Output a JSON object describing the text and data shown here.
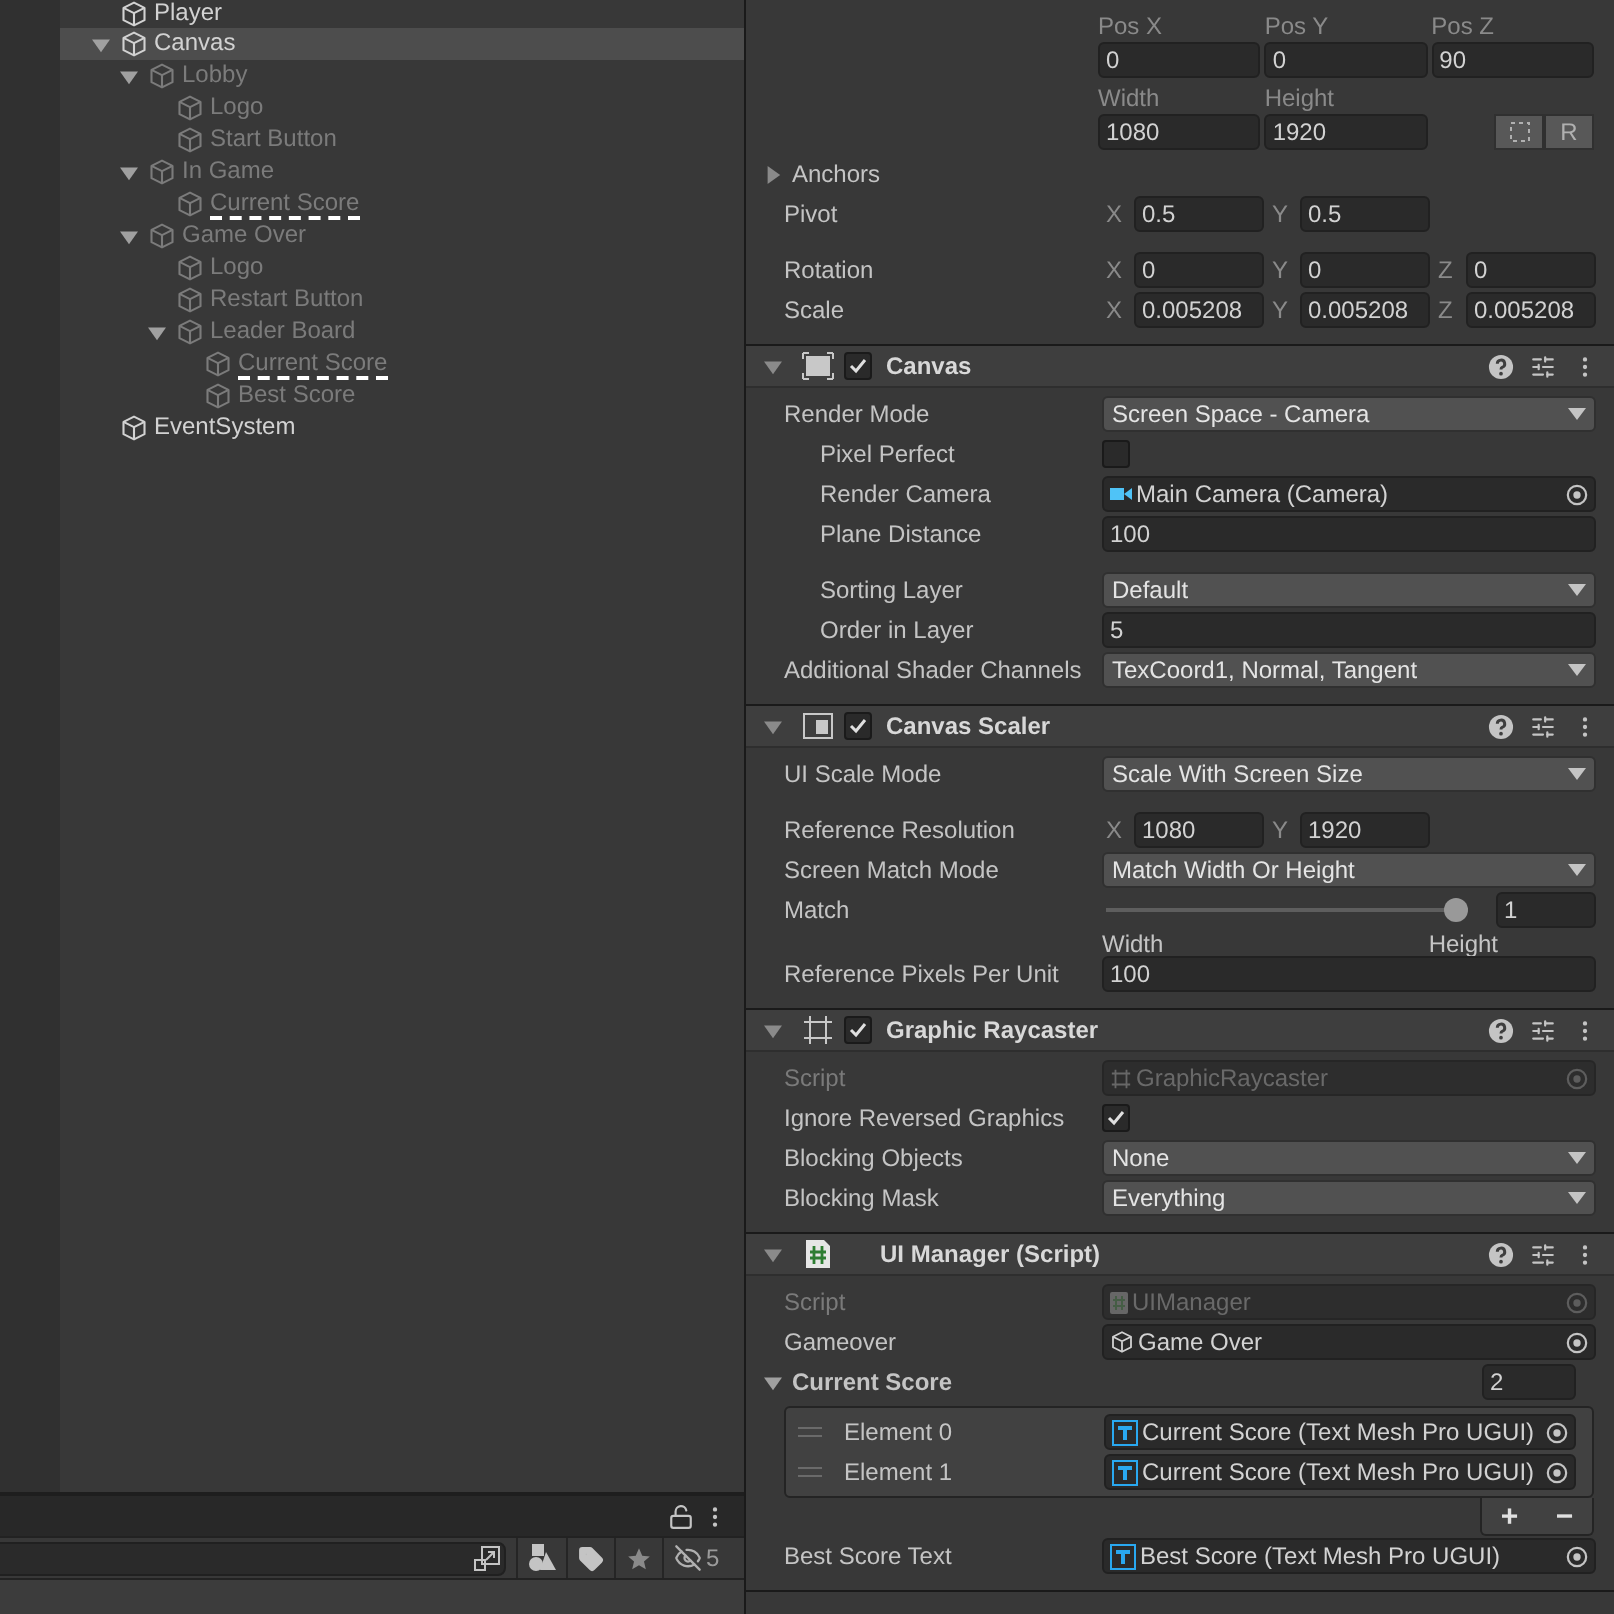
{
  "hierarchy": {
    "items": [
      {
        "name": "Player",
        "active": true,
        "selected": false
      },
      {
        "name": "Canvas",
        "active": true,
        "selected": true,
        "expanded": true,
        "children": [
          {
            "name": "Lobby",
            "active": false,
            "selected": false,
            "expanded": true,
            "children": [
              {
                "name": "Logo",
                "active": false,
                "selected": false
              },
              {
                "name": "Start Button",
                "active": false,
                "selected": false
              }
            ]
          },
          {
            "name": "In Game",
            "active": false,
            "selected": false,
            "expanded": true,
            "children": [
              {
                "name": "Current Score",
                "active": false,
                "selected": false,
                "marked": true
              }
            ]
          },
          {
            "name": "Game Over",
            "active": false,
            "selected": false,
            "expanded": true,
            "children": [
              {
                "name": "Logo",
                "active": false,
                "selected": false
              },
              {
                "name": "Restart Button",
                "active": false,
                "selected": false
              },
              {
                "name": "Leader Board",
                "active": false,
                "selected": false,
                "expanded": true,
                "children": [
                  {
                    "name": "Current Score",
                    "active": false,
                    "selected": false,
                    "marked": true
                  },
                  {
                    "name": "Best Score",
                    "active": false,
                    "selected": false
                  }
                ]
              }
            ]
          }
        ]
      },
      {
        "name": "EventSystem",
        "active": true,
        "selected": false
      }
    ]
  },
  "scene_filter": {
    "hidden_count": "5"
  },
  "inspector": {
    "rect_transform": {
      "position": [
        {
          "label": "Pos X",
          "value": "0"
        },
        {
          "label": "Pos Y",
          "value": "0"
        },
        {
          "label": "Pos Z",
          "value": "90"
        }
      ],
      "size": [
        {
          "label": "Width",
          "value": "1080"
        },
        {
          "label": "Height",
          "value": "1920"
        }
      ],
      "raw_edit_button": "R",
      "rows": [
        {
          "kind": "foldout",
          "label": "Anchors",
          "expanded": false
        },
        {
          "kind": "vector",
          "label": "Pivot",
          "axes": [
            {
              "axis": "X",
              "value": "0.5"
            },
            {
              "axis": "Y",
              "value": "0.5"
            }
          ]
        },
        {
          "kind": "vector",
          "label": "Rotation",
          "axes": [
            {
              "axis": "X",
              "value": "0"
            },
            {
              "axis": "Y",
              "value": "0"
            },
            {
              "axis": "Z",
              "value": "0"
            }
          ]
        },
        {
          "kind": "vector",
          "label": "Scale",
          "axes": [
            {
              "axis": "X",
              "value": "0.005208"
            },
            {
              "axis": "Y",
              "value": "0.005208"
            },
            {
              "axis": "Z",
              "value": "0.005208"
            }
          ]
        }
      ]
    },
    "components": [
      {
        "title": "Canvas",
        "expanded": true,
        "enabled": true,
        "rows": [
          {
            "kind": "dropdown",
            "label": "Render Mode",
            "value": "Screen Space - Camera"
          },
          {
            "kind": "checkbox",
            "label": "Pixel Perfect",
            "indent": true,
            "checked": false
          },
          {
            "kind": "object",
            "label": "Render Camera",
            "indent": true,
            "value": "Main Camera (Camera)"
          },
          {
            "kind": "field",
            "label": "Plane Distance",
            "indent": true,
            "value": "100"
          },
          {
            "kind": "dropdown",
            "label": "Sorting Layer",
            "indent": true,
            "value": "Default"
          },
          {
            "kind": "field",
            "label": "Order in Layer",
            "indent": true,
            "value": "5"
          },
          {
            "kind": "dropdown",
            "label": "Additional Shader Channels",
            "value": "TexCoord1, Normal, Tangent"
          }
        ]
      },
      {
        "title": "Canvas Scaler",
        "expanded": true,
        "enabled": true,
        "rows": [
          {
            "kind": "dropdown",
            "label": "UI Scale Mode",
            "value": "Scale With Screen Size"
          },
          {
            "kind": "vector",
            "label": "Reference Resolution",
            "axes": [
              {
                "axis": "X",
                "value": "1080"
              },
              {
                "axis": "Y",
                "value": "1920"
              }
            ]
          },
          {
            "kind": "dropdown",
            "label": "Screen Match Mode",
            "value": "Match Width Or Height"
          },
          {
            "kind": "slider",
            "label": "Match",
            "level": 1,
            "value": "1",
            "min_label": "Width",
            "max_label": "Height"
          },
          {
            "kind": "field",
            "label": "Reference Pixels Per Unit",
            "value": "100"
          }
        ]
      },
      {
        "title": "Graphic Raycaster",
        "expanded": true,
        "enabled": true,
        "rows": [
          {
            "kind": "object",
            "label": "Script",
            "disabled": true,
            "value": "GraphicRaycaster"
          },
          {
            "kind": "checkbox",
            "label": "Ignore Reversed Graphics",
            "checked": true
          },
          {
            "kind": "dropdown",
            "label": "Blocking Objects",
            "value": "None"
          },
          {
            "kind": "dropdown",
            "label": "Blocking Mask",
            "value": "Everything"
          }
        ]
      },
      {
        "title": "UI Manager (Script)",
        "expanded": true,
        "rows": [
          {
            "kind": "object",
            "label": "Script",
            "disabled": true,
            "value": "UIManager"
          },
          {
            "kind": "object",
            "label": "Gameover",
            "value": "Game Over"
          },
          {
            "kind": "list",
            "label": "Current Score",
            "expanded": true,
            "count": "2",
            "add_button": "+",
            "remove_button": "−",
            "elements": [
              {
                "label": "Element 0",
                "value": "Current Score (Text Mesh Pro UGUI)"
              },
              {
                "label": "Element 1",
                "value": "Current Score (Text Mesh Pro UGUI)"
              }
            ]
          },
          {
            "kind": "object",
            "label": "Best Score Text",
            "value": "Best Score (Text Mesh Pro UGUI)"
          }
        ]
      }
    ]
  }
}
